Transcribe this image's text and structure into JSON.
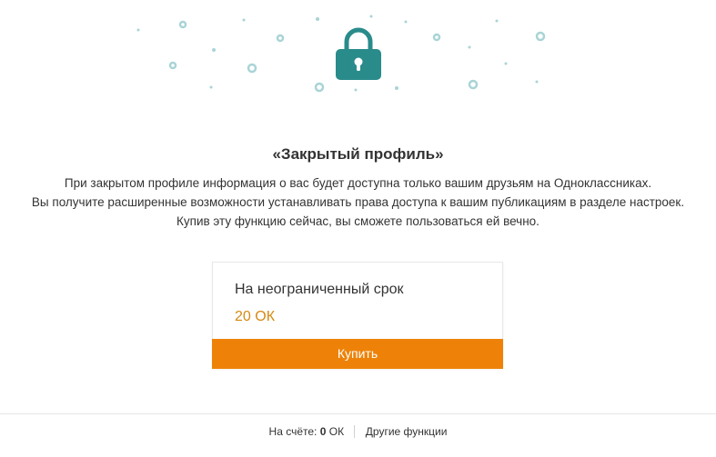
{
  "hero": {
    "icon": "lock-icon",
    "accent_color": "#2a8b8b",
    "decoration_color": "#a9d4d6"
  },
  "title": "«Закрытый профиль»",
  "description": [
    "При закрытом профиле информация о вас будет доступна только вашим друзьям на Одноклассниках.",
    "Вы получите расширенные возможности устанавливать права доступа к вашим публикациям в разделе настроек.",
    "Купив эту функцию сейчас, вы сможете пользоваться ей вечно."
  ],
  "offer": {
    "title": "На неограниченный срок",
    "price": "20 ОК",
    "price_color": "#d58a14",
    "buy_label": "Купить",
    "button_color": "#ee8208"
  },
  "footer": {
    "balance_label": "На счёте:",
    "balance_value": "0",
    "balance_currency": "ОК",
    "other_functions": "Другие функции"
  }
}
